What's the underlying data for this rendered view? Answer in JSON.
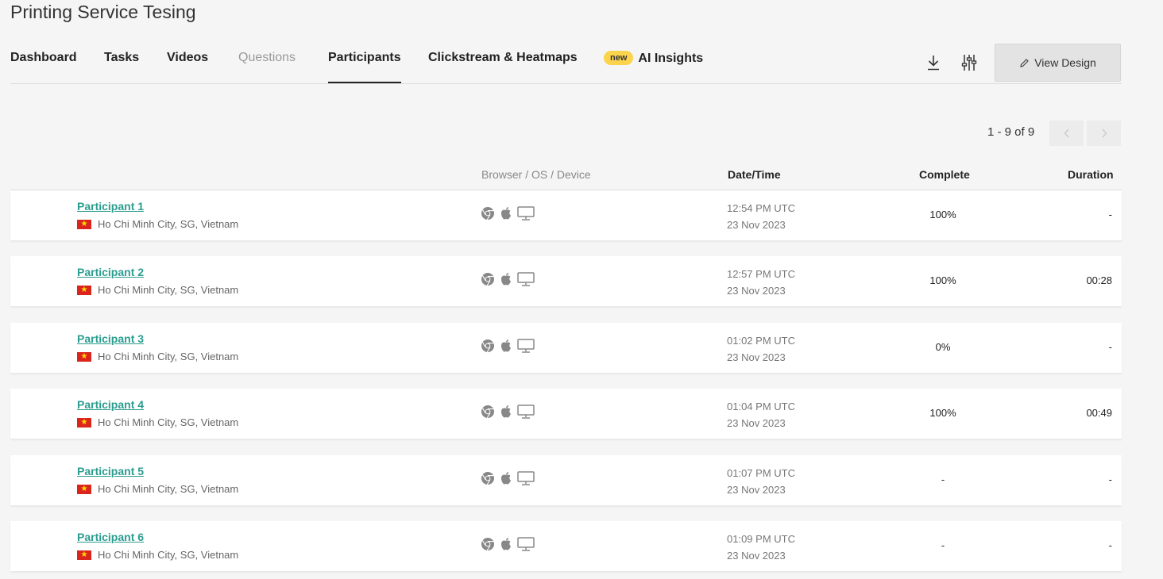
{
  "page": {
    "title": "Printing Service Tesing"
  },
  "nav": {
    "tabs": [
      {
        "label": "Dashboard"
      },
      {
        "label": "Tasks"
      },
      {
        "label": "Videos"
      },
      {
        "label": "Questions"
      },
      {
        "label": "Participants"
      },
      {
        "label": "Clickstream & Heatmaps"
      },
      {
        "label": "AI Insights",
        "badge": "new"
      }
    ],
    "active_tab": "Participants",
    "view_design_label": "View Design"
  },
  "pagination": {
    "text": "1 - 9 of 9"
  },
  "columns": {
    "browser": "Browser / OS / Device",
    "datetime": "Date/Time",
    "complete": "Complete",
    "duration": "Duration"
  },
  "participants": [
    {
      "name": "Participant 1",
      "location": "Ho Chi Minh City, SG, Vietnam",
      "time": "12:54 PM UTC",
      "date": "23 Nov 2023",
      "complete": "100%",
      "duration": "-"
    },
    {
      "name": "Participant 2",
      "location": "Ho Chi Minh City, SG, Vietnam",
      "time": "12:57 PM UTC",
      "date": "23 Nov 2023",
      "complete": "100%",
      "duration": "00:28"
    },
    {
      "name": "Participant 3",
      "location": "Ho Chi Minh City, SG, Vietnam",
      "time": "01:02 PM UTC",
      "date": "23 Nov 2023",
      "complete": "0%",
      "duration": "-"
    },
    {
      "name": "Participant 4",
      "location": "Ho Chi Minh City, SG, Vietnam",
      "time": "01:04 PM UTC",
      "date": "23 Nov 2023",
      "complete": "100%",
      "duration": "00:49"
    },
    {
      "name": "Participant 5",
      "location": "Ho Chi Minh City, SG, Vietnam",
      "time": "01:07 PM UTC",
      "date": "23 Nov 2023",
      "complete": "-",
      "duration": "-"
    },
    {
      "name": "Participant 6",
      "location": "Ho Chi Minh City, SG, Vietnam",
      "time": "01:09 PM UTC",
      "date": "23 Nov 2023",
      "complete": "-",
      "duration": "-"
    }
  ],
  "icons": {
    "browser": "chrome-icon",
    "os": "apple-icon",
    "device": "desktop-icon",
    "flag": "vietnam-flag-icon"
  },
  "colors": {
    "link": "#2a9d8f",
    "badge": "#fcd34d",
    "flag_red": "#da251d",
    "flag_star": "#ffde00"
  }
}
